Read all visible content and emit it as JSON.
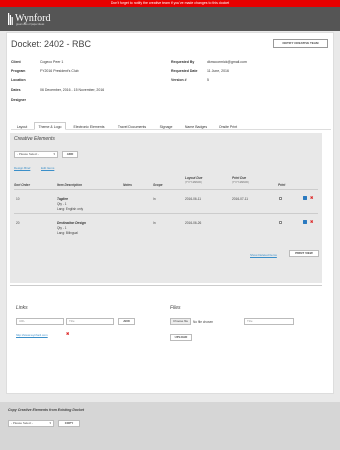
{
  "banner": "Don't forget to notify the creative team if you've made changes to this docket",
  "brand": {
    "name": "Wynford",
    "tagline": "great uses of paper ideas"
  },
  "docket": {
    "title": "Docket: 2402 - RBC",
    "notify_label": "NOTIFY CREATIVE TEAM",
    "fields_left": [
      {
        "label": "Client",
        "value": "Cogeco Peer 1"
      },
      {
        "label": "Program",
        "value": "FY2016 President's Club"
      },
      {
        "label": "Location",
        "value": ""
      },
      {
        "label": "Dates",
        "value": "06 December, 2016 - 15 November, 2016"
      },
      {
        "label": "Designer",
        "value": ""
      }
    ],
    "fields_right": [
      {
        "label": "Requested By",
        "value": "dkmccormick@gmail.com"
      },
      {
        "label": "Requested Date",
        "value": "11 June, 2016"
      },
      {
        "label": "Version #",
        "value": "5"
      }
    ]
  },
  "tabs": [
    "Layout",
    "Theme & Logo",
    "Electronic Elements",
    "Travel Documents",
    "Signage",
    "Name Badges",
    "Onsite Print"
  ],
  "active_tab": 1,
  "creative": {
    "title": "Creative Elements",
    "select_placeholder": "- Please Select -",
    "add_label": "ADD",
    "design_brief": "Design Brief",
    "edit_items": "Edit Items",
    "headers": {
      "sort_order": "Sort Order",
      "item_description": "Item Description",
      "notes": "Notes",
      "scope": "Scope",
      "layout_due": "Layout Due",
      "layout_due_fmt": "(YYYY-MM-DD)",
      "print_due": "Print Due",
      "print_due_fmt": "(YYYY-MM-DD)",
      "print": "Print"
    },
    "rows": [
      {
        "sort": "10",
        "name": "Tagline",
        "qty": "Qty - 1",
        "lang": "Lang: English only",
        "notes": "",
        "scope": "In",
        "layout_due": "2016-06-11",
        "print_due": "2016-07-11"
      },
      {
        "sort": "20",
        "name": "Destination Design",
        "qty": "Qty - 1",
        "lang": "Lang: Bilingual",
        "notes": "",
        "scope": "In",
        "layout_due": "2016-06-26",
        "print_due": ""
      }
    ],
    "show_deleted": "Show Deleted Items",
    "print_view": "PRINT VIEW"
  },
  "links": {
    "title": "Links",
    "url_placeholder": "URL",
    "title_placeholder": "Title",
    "add_label": "ADD",
    "existing": "http://www.wynford.com"
  },
  "files": {
    "title": "Files",
    "choose_label": "Choose file",
    "no_file": "No file chosen",
    "title_placeholder": "Title",
    "upload_label": "UPLOAD"
  },
  "copy": {
    "title": "Copy Creative Elements from Existing Docket",
    "select_placeholder": "- Please Select -",
    "copy_label": "COPY"
  }
}
